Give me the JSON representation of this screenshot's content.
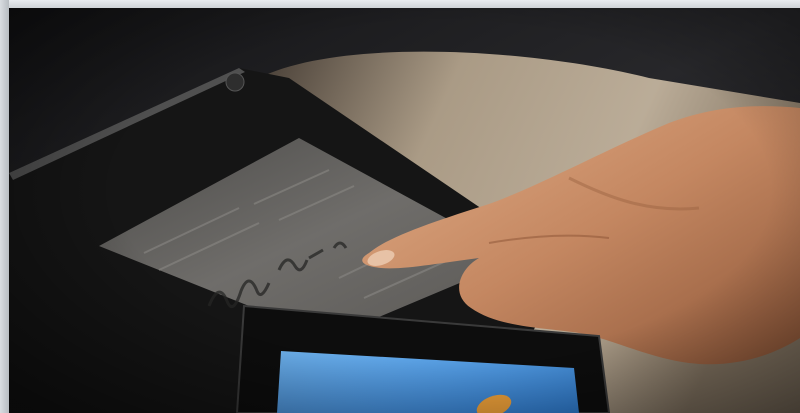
{
  "scene": {
    "subject": "finger-touching-tablet-signature-screen",
    "colors": {
      "background": "#1f1f21",
      "counter": "#b9a48a",
      "tablet_body": "#161616",
      "tablet_screen": "#6b6a68",
      "skin": "#c58a62",
      "front_tablet_screen": "#3e8fdc",
      "front_tablet_accent": "#f2a33a"
    }
  }
}
